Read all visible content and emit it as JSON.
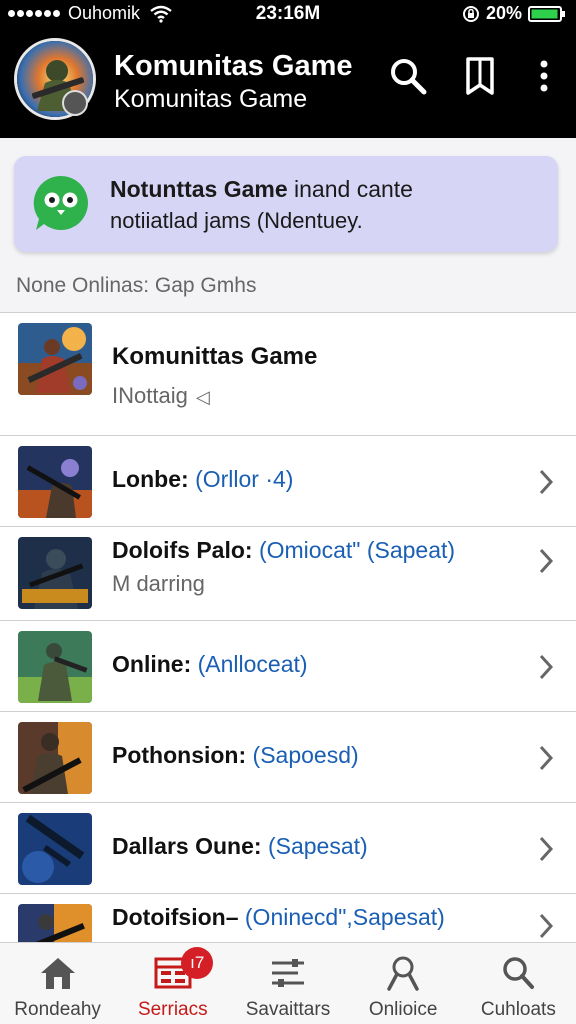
{
  "status_bar": {
    "carrier": "Ouhomik",
    "time": "23:16M",
    "battery": "20%"
  },
  "header": {
    "title": "Komunitas Game",
    "subtitle": "Komunitas Game",
    "icons": [
      "search-icon",
      "bookmark-icon",
      "more-vertical-icon"
    ]
  },
  "notification": {
    "line1_bold": "Notunttas Game",
    "line1_rest": " inand cante",
    "line2": "notiiatlad jams (Ndentuey.",
    "icon": "chat-owl-icon",
    "accent": "#2fb14b"
  },
  "section_label": "None Onlinas: Gap Gmhs",
  "featured": {
    "name": "Komunittas Game",
    "status": "INottaig",
    "caret": "◁"
  },
  "games": [
    {
      "name": "Lonbe",
      "meta": "(Orllor ·4)"
    },
    {
      "name": "Doloifs Palo",
      "meta": "(Omiocat\" (Sapeat)",
      "sub": "M darring"
    },
    {
      "name": "Online",
      "meta": "(Anlloceat)"
    },
    {
      "name": "Pothonsion",
      "meta": "(Sapoesd)"
    },
    {
      "name": "Dallars Oune",
      "meta": "(Sapesat)"
    },
    {
      "name": "Dotoifsion",
      "meta": "(Oninecd\",Sapesat)"
    }
  ],
  "nav": [
    {
      "label": "Rondeahy",
      "icon": "home-icon"
    },
    {
      "label": "Serriacs",
      "icon": "calendar-grid-icon",
      "badge": "ı7"
    },
    {
      "label": "Savaittars",
      "icon": "sliders-icon"
    },
    {
      "label": "Onlioice",
      "icon": "user-icon"
    },
    {
      "label": "Cuhloats",
      "icon": "search-icon"
    }
  ],
  "colors": {
    "header_bg": "#000000",
    "card_bg": "#d7d5f6",
    "link": "#1a5fb4",
    "active_nav": "#c41a1a",
    "badge": "#d41f26"
  }
}
